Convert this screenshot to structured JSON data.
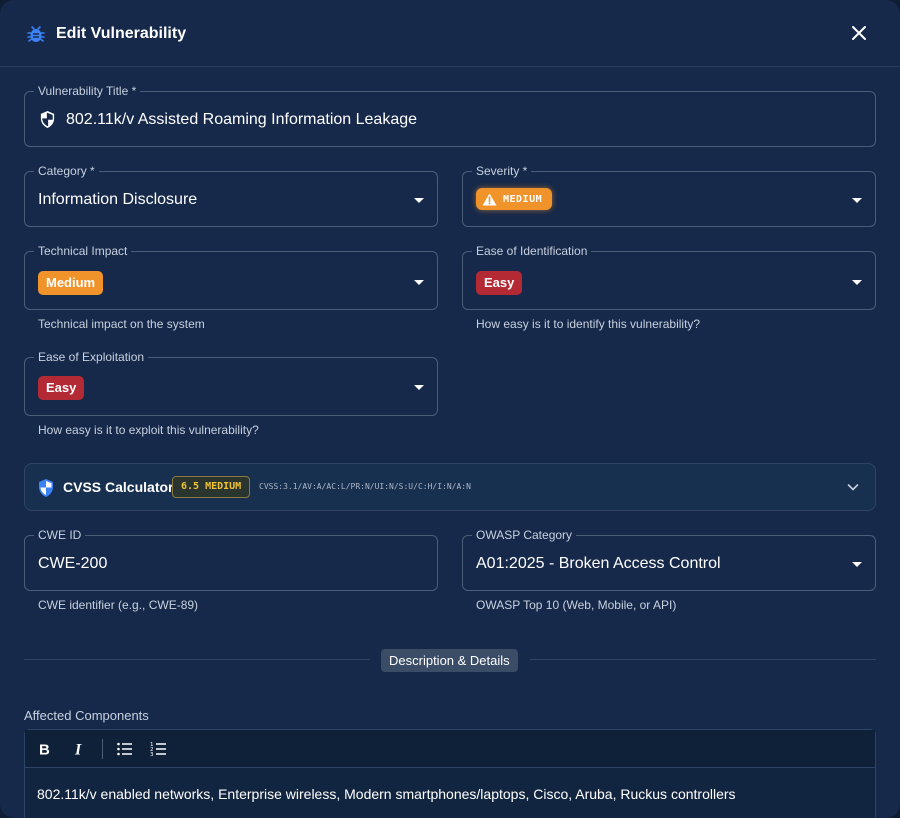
{
  "dialog": {
    "title": "Edit Vulnerability",
    "accent_color": "#3b82f6"
  },
  "fields": {
    "title": {
      "label": "Vulnerability Title *",
      "value": "802.11k/v Assisted Roaming Information Leakage"
    },
    "category": {
      "label": "Category *",
      "value": "Information Disclosure"
    },
    "severity": {
      "label": "Severity *",
      "value": "MEDIUM",
      "color": "#f0932b"
    },
    "technical_impact": {
      "label": "Technical Impact",
      "value": "Medium",
      "helper": "Technical impact on the system",
      "color": "#f0932b"
    },
    "ease_identification": {
      "label": "Ease of Identification",
      "value": "Easy",
      "helper": "How easy is it to identify this vulnerability?",
      "color": "#b32a35"
    },
    "ease_exploitation": {
      "label": "Ease of Exploitation",
      "value": "Easy",
      "helper": "How easy is it to exploit this vulnerability?",
      "color": "#b32a35"
    },
    "cwe": {
      "label": "CWE ID",
      "value": "CWE-200",
      "helper": "CWE identifier (e.g., CWE-89)"
    },
    "owasp": {
      "label": "OWASP Category",
      "value": "A01:2025 - Broken Access Control",
      "helper": "OWASP Top 10 (Web, Mobile, or API)"
    }
  },
  "cvss": {
    "title": "CVSS Calculator",
    "score": "6.5 MEDIUM",
    "vector": "CVSS:3.1/AV:A/AC:L/PR:N/UI:N/S:U/C:H/I:N/A:N"
  },
  "section": {
    "label": "Description & Details"
  },
  "affected": {
    "label": "Affected Components",
    "text": "802.11k/v enabled networks, Enterprise wireless, Modern smartphones/laptops, Cisco, Aruba, Ruckus controllers",
    "toolbar": [
      "bold-icon",
      "italic-icon",
      "bulleted-list-icon",
      "numbered-list-icon"
    ]
  }
}
